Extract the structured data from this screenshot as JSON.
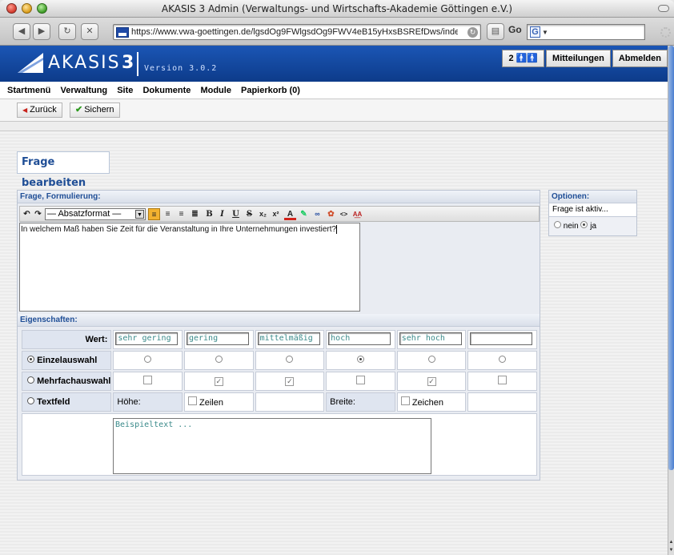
{
  "window": {
    "title": "AKASIS 3 Admin (Verwaltungs- und Wirtschafts-Akademie Göttingen e.V.)"
  },
  "browser": {
    "url": "https://www.vwa-goettingen.de/lgsdOg9FWlgsdOg9FWV4eB15yHxsBSREfDws/inde:",
    "go_label": "Go",
    "google_letter": "G"
  },
  "banner": {
    "logo_word": "AKASIS",
    "logo_number": "3",
    "version": "Version 3.0.2",
    "users_count": "2",
    "buttons": [
      "Mitteilungen",
      "Abmelden"
    ]
  },
  "nav": {
    "items": [
      "Startmenü",
      "Verwaltung",
      "Site",
      "Dokumente",
      "Module",
      "Papierkorb (0)"
    ]
  },
  "actions": {
    "back": "Zurück",
    "save": "Sichern"
  },
  "heading": "Frage bearbeiten",
  "question": {
    "section_title": "Frage, Formulierung:",
    "format_select": "— Absatzformat —",
    "text": "In welchem Maß haben Sie Zeit für die Veranstaltung in Ihre Unternehmungen investiert?"
  },
  "properties": {
    "section_title": "Eigenschaften:",
    "wert_label": "Wert:",
    "values": [
      "sehr gering",
      "gering",
      "mittelmäßig",
      "hoch",
      "sehr hoch",
      ""
    ],
    "einzel_label": "Einzelauswahl",
    "einzel_selected_index": 3,
    "mehrfach_label": "Mehrfachauswahl",
    "mehrfach_checked": [
      false,
      true,
      true,
      false,
      true,
      false
    ],
    "text_label": "Textfeld",
    "height_label": "Höhe:",
    "rows_label": "Zeilen",
    "width_label": "Breite:",
    "chars_label": "Zeichen",
    "sample_text": "Beispieltext ..."
  },
  "options": {
    "title": "Optionen:",
    "active_label": "Frage ist aktiv...",
    "no_label": "nein",
    "yes_label": "ja"
  }
}
